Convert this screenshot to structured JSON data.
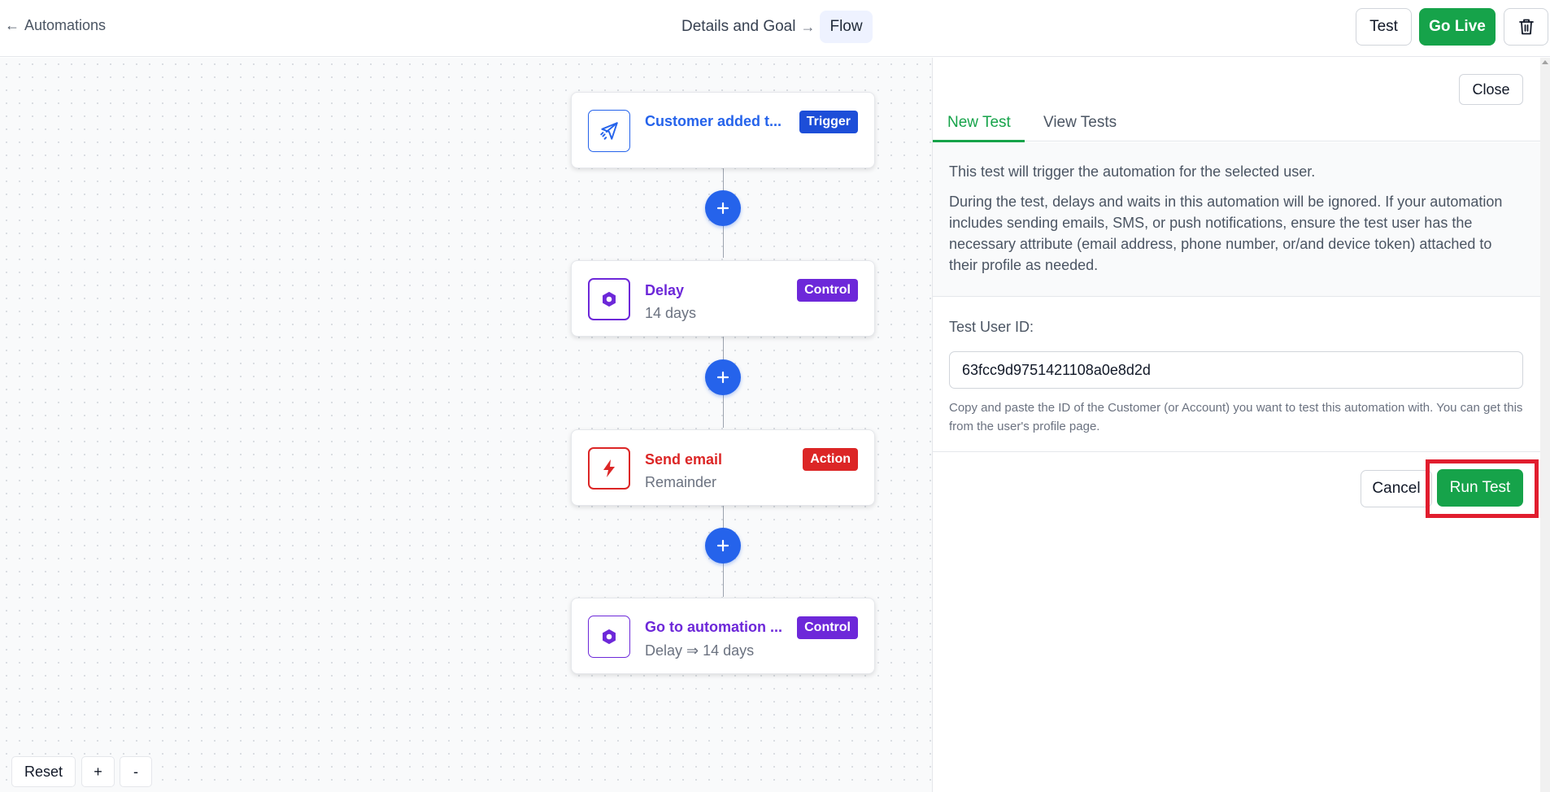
{
  "header": {
    "back_arrow": "←",
    "back_label": "Automations",
    "breadcrumb_step1": "Details and Goal",
    "breadcrumb_sep": "→",
    "breadcrumb_step2": "Flow",
    "test_label": "Test",
    "go_live_label": "Go Live",
    "delete_icon": "trash-icon"
  },
  "flow": {
    "nodes": [
      {
        "title": "Customer added t...",
        "subtitle": "",
        "badge": "Trigger",
        "icon": "send-icon",
        "color": "#2563eb"
      },
      {
        "title": "Delay",
        "subtitle": "14 days",
        "badge": "Control",
        "icon": "hexagon-icon",
        "color": "#6d28d9"
      },
      {
        "title": "Send email",
        "subtitle": "Remainder",
        "badge": "Action",
        "icon": "lightning-icon",
        "color": "#dc2626"
      },
      {
        "title": "Go to automation ...",
        "subtitle": "Delay ⇒ 14 days",
        "badge": "Control",
        "icon": "hexagon-icon",
        "color": "#6d28d9"
      }
    ],
    "add_step_symbol": "+",
    "controls": {
      "reset": "Reset",
      "zoom_in": "+",
      "zoom_out": "-"
    }
  },
  "panel": {
    "close_label": "Close",
    "tabs": [
      "New Test",
      "View Tests"
    ],
    "active_tab": "New Test",
    "info_line1": "This test will trigger the automation for the selected user.",
    "info_line2": "During the test, delays and waits in this automation will be ignored. If your automation includes sending emails, SMS, or push notifications, ensure the test user has the necessary attribute (email address, phone number, or/and device token) attached to their profile as needed.",
    "field_label": "Test User ID:",
    "field_value": "63fcc9d9751421108a0e8d2d",
    "help_text": "Copy and paste the ID of the Customer (or Account) you want to test this automation with. You can get this from the user's profile page.",
    "cancel_label": "Cancel",
    "run_label": "Run Test"
  },
  "colors": {
    "primary_green": "#16a34a",
    "trigger_blue": "#2563eb",
    "control_purple": "#6d28d9",
    "action_red": "#dc2626",
    "highlight_red": "#e11d2e"
  }
}
